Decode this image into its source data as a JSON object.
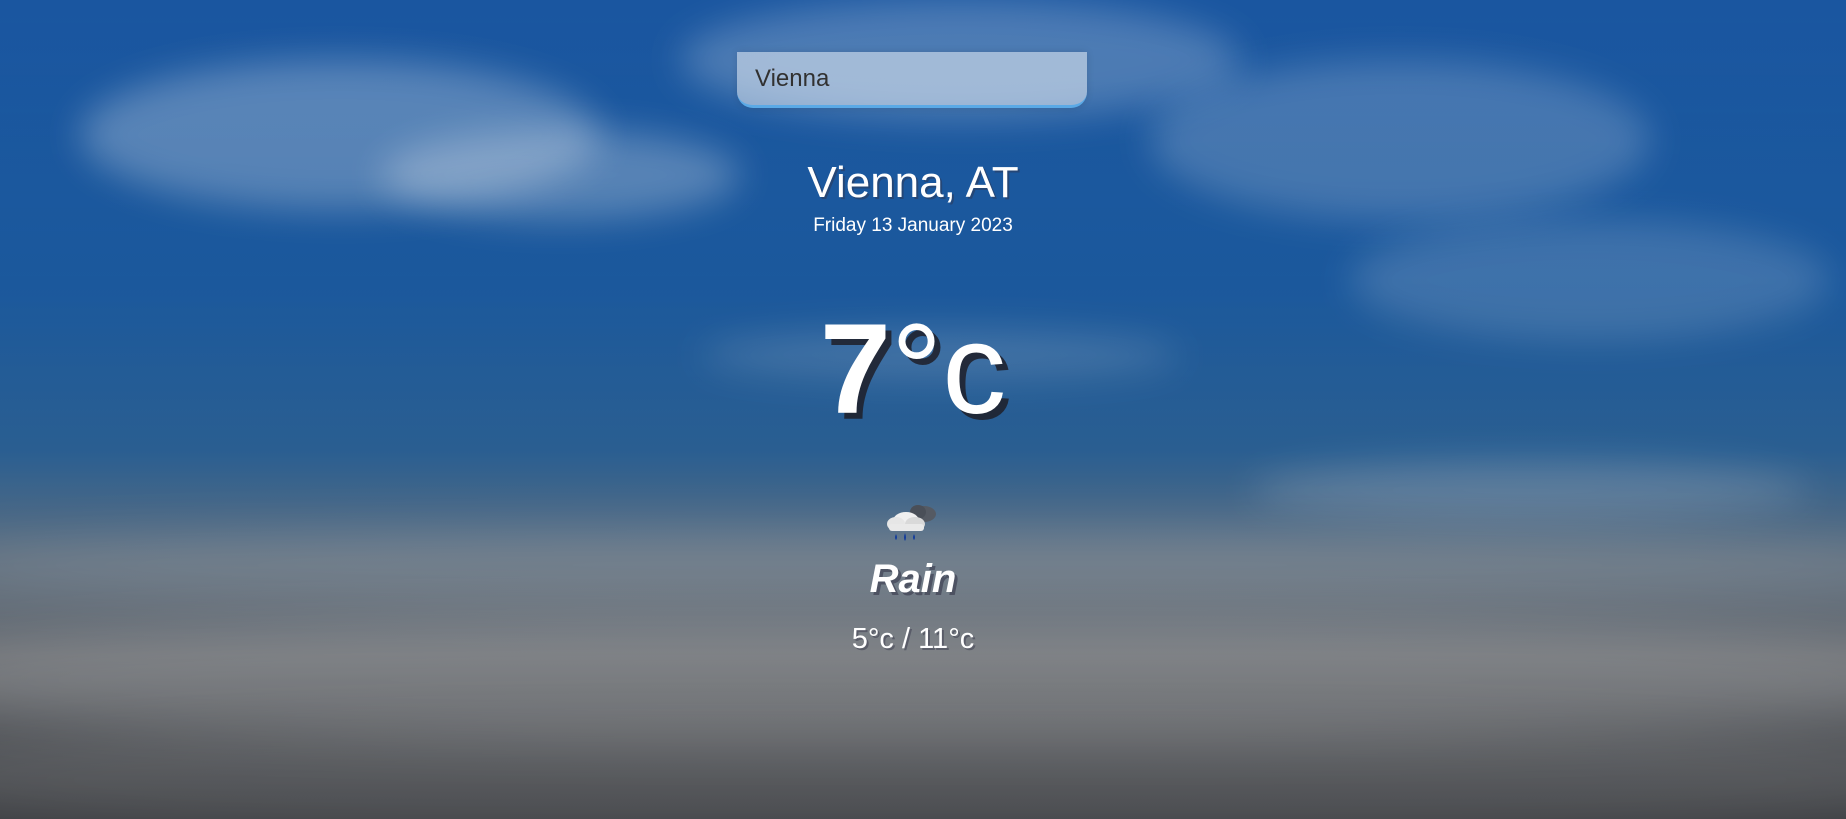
{
  "search": {
    "value": "Vienna",
    "placeholder": ""
  },
  "location": {
    "label": "Vienna, AT",
    "date": "Friday 13 January 2023"
  },
  "temperature": {
    "value": "7",
    "unit": "°c"
  },
  "weather": {
    "icon": "rain-cloud-icon",
    "description": "Rain",
    "range": "5°c / 11°c"
  },
  "colors": {
    "search_underline": "#5aa9e6",
    "text": "#ffffff"
  }
}
